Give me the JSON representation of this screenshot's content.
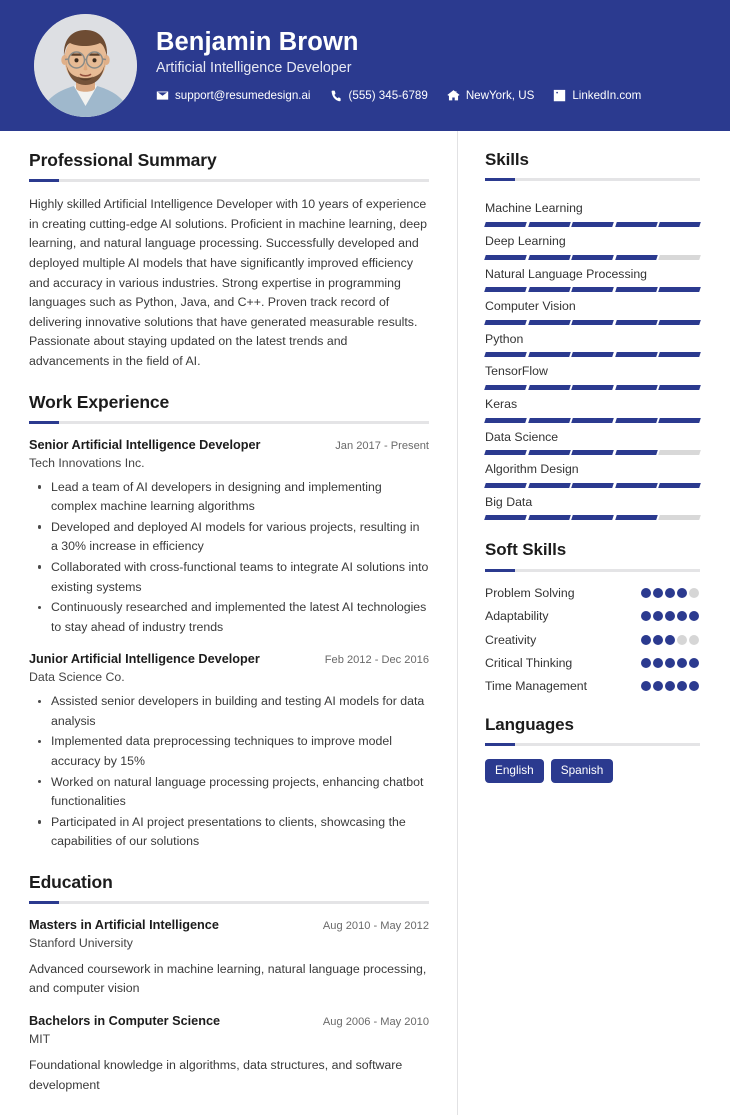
{
  "header": {
    "name": "Benjamin Brown",
    "job_title": "Artificial Intelligence Developer",
    "background_color": "#2b3a8f",
    "contacts": [
      {
        "icon": "envelope-icon",
        "label": "support@resumedesign.ai"
      },
      {
        "icon": "phone-icon",
        "label": "(555) 345-6789"
      },
      {
        "icon": "home-icon",
        "label": "NewYork, US"
      },
      {
        "icon": "linkedin-icon",
        "label": "LinkedIn.com"
      }
    ],
    "avatar_alt": "Profile photo of Benjamin Brown"
  },
  "accent_color": "#2b3a8f",
  "main": {
    "summary": {
      "title": "Professional Summary",
      "text": "Highly skilled Artificial Intelligence Developer with 10 years of experience in creating cutting-edge AI solutions. Proficient in machine learning, deep learning, and natural language processing. Successfully developed and deployed multiple AI models that have significantly improved efficiency and accuracy in various industries. Strong expertise in programming languages such as Python, Java, and C++. Proven track record of delivering innovative solutions that have generated measurable results. Passionate about staying updated on the latest trends and advancements in the field of AI."
    },
    "experience": {
      "title": "Work Experience",
      "entries": [
        {
          "role": "Senior Artificial Intelligence Developer",
          "date": "Jan 2017 - Present",
          "organization": "Tech Innovations Inc.",
          "bullets": [
            "Lead a team of AI developers in designing and implementing complex machine learning algorithms",
            "Developed and deployed AI models for various projects, resulting in a 30% increase in efficiency",
            "Collaborated with cross-functional teams to integrate AI solutions into existing systems",
            "Continuously researched and implemented the latest AI technologies to stay ahead of industry trends"
          ]
        },
        {
          "role": "Junior Artificial Intelligence Developer",
          "date": "Feb 2012 - Dec 2016",
          "organization": "Data Science Co.",
          "bullets": [
            "Assisted senior developers in building and testing AI models for data analysis",
            "Implemented data preprocessing techniques to improve model accuracy by 15%",
            "Worked on natural language processing projects, enhancing chatbot functionalities",
            "Participated in AI project presentations to clients, showcasing the capabilities of our solutions"
          ]
        }
      ]
    },
    "education": {
      "title": "Education",
      "entries": [
        {
          "role": "Masters in Artificial Intelligence",
          "date": "Aug 2010 - May 2012",
          "organization": "Stanford University",
          "description": "Advanced coursework in machine learning, natural language processing, and computer vision"
        },
        {
          "role": "Bachelors in Computer Science",
          "date": "Aug 2006 - May 2010",
          "organization": "MIT",
          "description": "Foundational knowledge in algorithms, data structures, and software development"
        }
      ]
    }
  },
  "sidebar": {
    "skills": {
      "title": "Skills",
      "max": 5,
      "items": [
        {
          "label": "Machine Learning",
          "level": 5
        },
        {
          "label": "Deep Learning",
          "level": 4
        },
        {
          "label": "Natural Language Processing",
          "level": 5
        },
        {
          "label": "Computer Vision",
          "level": 5
        },
        {
          "label": "Python",
          "level": 5
        },
        {
          "label": "TensorFlow",
          "level": 5
        },
        {
          "label": "Keras",
          "level": 5
        },
        {
          "label": "Data Science",
          "level": 4
        },
        {
          "label": "Algorithm Design",
          "level": 5
        },
        {
          "label": "Big Data",
          "level": 4
        }
      ]
    },
    "soft_skills": {
      "title": "Soft Skills",
      "max": 5,
      "items": [
        {
          "label": "Problem Solving",
          "level": 4
        },
        {
          "label": "Adaptability",
          "level": 5
        },
        {
          "label": "Creativity",
          "level": 3
        },
        {
          "label": "Critical Thinking",
          "level": 5
        },
        {
          "label": "Time Management",
          "level": 5
        }
      ]
    },
    "languages": {
      "title": "Languages",
      "items": [
        "English",
        "Spanish"
      ]
    }
  }
}
